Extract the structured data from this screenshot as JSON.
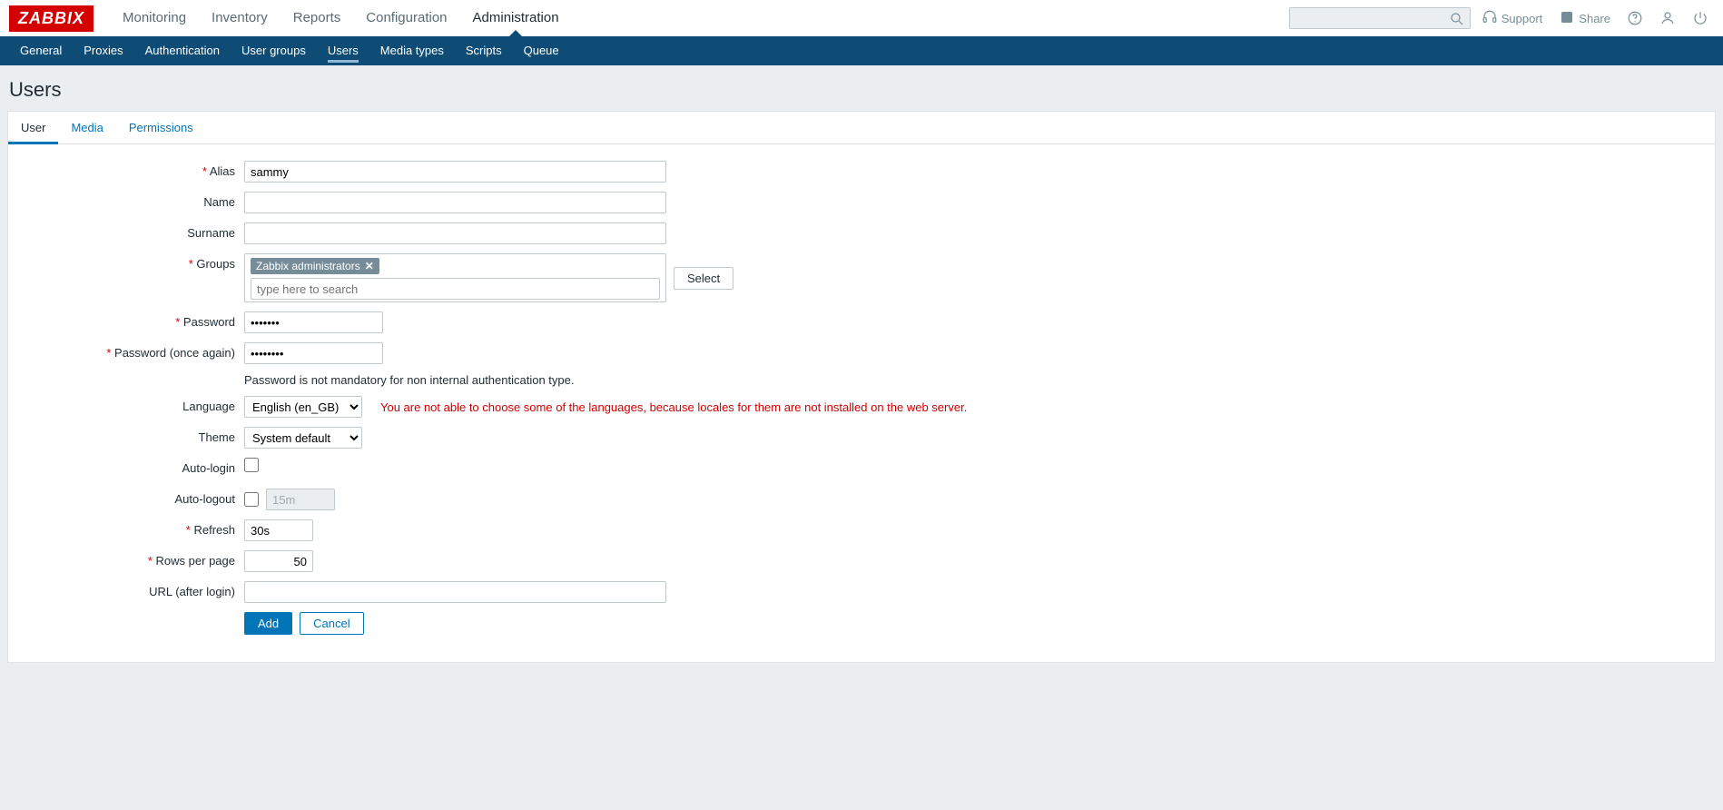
{
  "brand": "ZABBIX",
  "mainnav": {
    "monitoring": "Monitoring",
    "inventory": "Inventory",
    "reports": "Reports",
    "configuration": "Configuration",
    "administration": "Administration"
  },
  "top": {
    "support": "Support",
    "share": "Share"
  },
  "subnav": {
    "general": "General",
    "proxies": "Proxies",
    "authentication": "Authentication",
    "usergroups": "User groups",
    "users": "Users",
    "mediatypes": "Media types",
    "scripts": "Scripts",
    "queue": "Queue"
  },
  "page_title": "Users",
  "tabs": {
    "user": "User",
    "media": "Media",
    "permissions": "Permissions"
  },
  "labels": {
    "alias": "Alias",
    "name": "Name",
    "surname": "Surname",
    "groups": "Groups",
    "password": "Password",
    "password2": "Password (once again)",
    "language": "Language",
    "theme": "Theme",
    "autologin": "Auto-login",
    "autologout": "Auto-logout",
    "refresh": "Refresh",
    "rows": "Rows per page",
    "url": "URL (after login)"
  },
  "values": {
    "alias": "sammy",
    "name": "",
    "surname": "",
    "group_tag": "Zabbix administrators",
    "group_placeholder": "type here to search",
    "password": "•••••••",
    "password2": "••••••••",
    "password_note": "Password is not mandatory for non internal authentication type.",
    "language": "English (en_GB)",
    "language_warn": "You are not able to choose some of the languages, because locales for them are not installed on the web server.",
    "theme": "System default",
    "autologout_value": "15m",
    "refresh": "30s",
    "rows": "50",
    "url": ""
  },
  "buttons": {
    "select": "Select",
    "add": "Add",
    "cancel": "Cancel"
  }
}
